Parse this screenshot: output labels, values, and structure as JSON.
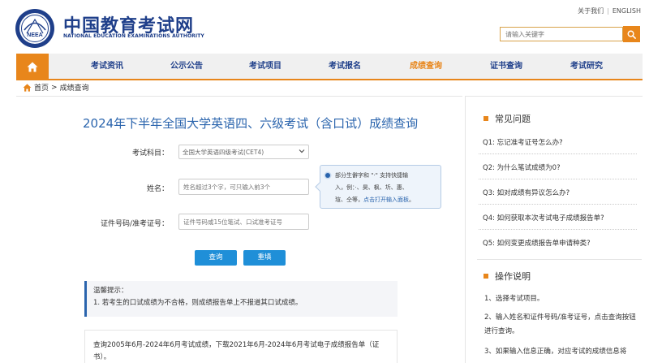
{
  "colors": {
    "brand_blue": "#1f3f8a",
    "accent_orange": "#e8861b",
    "link_blue": "#2a64ad",
    "button_blue": "#1f8fd8"
  },
  "header": {
    "logo_text_cn": "中国教育考试网",
    "logo_text_en": "NATIONAL EDUCATION EXAMINATIONS AUTHORITY",
    "logo_emblem_text": "NEEA",
    "links": {
      "about": "关于我们",
      "sep": "|",
      "english": "ENGLISH"
    },
    "search_placeholder": "请输入关键字",
    "search_icon": "search-icon"
  },
  "nav": {
    "home_icon": "home-icon",
    "items": [
      {
        "label": "考试资讯"
      },
      {
        "label": "公示公告"
      },
      {
        "label": "考试项目"
      },
      {
        "label": "考试报名"
      },
      {
        "label": "成绩查询",
        "active": true
      },
      {
        "label": "证书查询"
      },
      {
        "label": "考试研究"
      }
    ]
  },
  "breadcrumb": {
    "home": "首页",
    "sep": ">",
    "current": "成绩查询"
  },
  "form": {
    "title": "2024年下半年全国大学英语四、六级考试（含口试）成绩查询",
    "subject_label": "考试科目：",
    "subject_value": "全国大学英语四级考试(CET4)",
    "name_label": "姓名：",
    "name_placeholder": "姓名超过3个字，可只输入前3个",
    "id_label": "证件号码/准考证号：",
    "id_placeholder": "证件号码或15位笔试、口试准考证号",
    "tip_line1": "部分生僻字和 \"·\" 支持快捷输",
    "tip_line2": "入，例：·、昊、枫、圻、惠、",
    "tip_line3": "瑄、仝等，",
    "tip_link": "点击打开输入面板",
    "tip_end": "。",
    "query_button": "查询",
    "reset_button": "重填"
  },
  "notice": {
    "title": "温馨提示：",
    "line1": "1. 若考生的口试成绩为不合格，则成绩报告单上不报道其口试成绩。"
  },
  "history": {
    "text": "查询2005年6月-2024年6月考试成绩，下载2021年6月-2024年6月考试电子成绩报告单（证书）。"
  },
  "sidebar": {
    "faq_title": "常见问题",
    "faq": [
      "Q1:  忘记准考证号怎么办?",
      "Q2:  为什么笔试成绩为0?",
      "Q3:  如对成绩有异议怎么办?",
      "Q4:  如何获取本次考试电子成绩报告单?",
      "Q5:  如何变更成绩报告单申请种类?"
    ],
    "ops_title": "操作说明",
    "ops": [
      "1、选择考试项目。",
      "2、输入姓名和证件号码/准考证号，点击查询按钮进行查询。",
      "3、如果输入信息正确，对应考试的成绩信息将"
    ]
  }
}
